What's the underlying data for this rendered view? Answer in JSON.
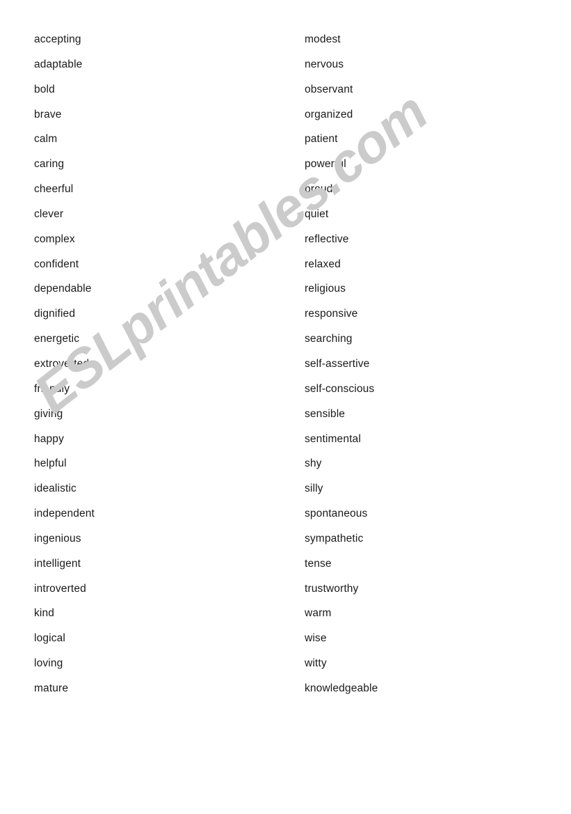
{
  "document": {
    "type": "worksheet",
    "background_color": "#ffffff",
    "text_color": "#1a1a1a"
  },
  "watermark": {
    "text": "ESLprintables.com",
    "color": "#cbcbcb",
    "rotation_degrees": -38
  },
  "columns": {
    "left": {
      "name": "left-word-column",
      "words": [
        "accepting",
        "adaptable",
        "bold",
        "brave",
        "calm",
        "caring",
        "cheerful",
        "clever",
        "complex",
        "confident",
        "dependable",
        "dignified",
        "energetic",
        "extroverted",
        "friendly",
        "giving",
        "happy",
        "helpful",
        "idealistic",
        "independent",
        "ingenious",
        "intelligent",
        "introverted",
        "kind",
        "logical",
        "loving",
        "mature"
      ]
    },
    "right": {
      "name": "right-word-column",
      "words": [
        "modest",
        "nervous",
        "observant",
        "organized",
        "patient",
        "powerful",
        "proud",
        "quiet",
        "reflective",
        "relaxed",
        "religious",
        "responsive",
        "searching",
        "self-assertive",
        "self-conscious",
        "sensible",
        "sentimental",
        "shy",
        "silly",
        "spontaneous",
        "sympathetic",
        "tense",
        "trustworthy",
        "warm",
        "wise",
        "witty",
        "knowledgeable"
      ]
    }
  }
}
